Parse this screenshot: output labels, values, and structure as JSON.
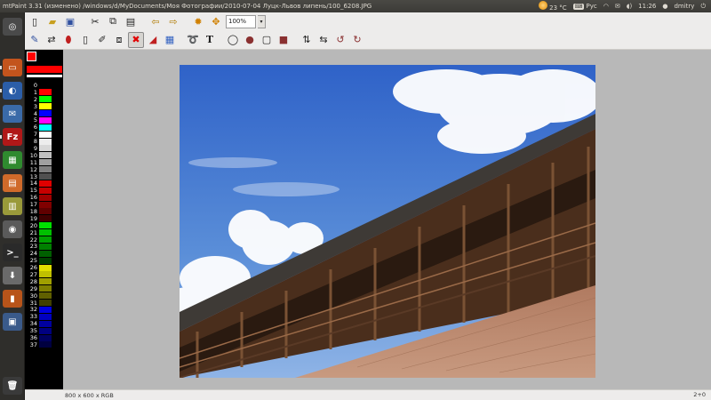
{
  "panel": {
    "title": "mtPaint 3.31 (изменено) /windows/d/MyDocuments/Моя Фотографии/2010-07-04 Луцк-Львов липень/100_6208.JPG",
    "weather": "23 °C",
    "keyboard": "Рус",
    "time": "11:26",
    "user": "dmitry"
  },
  "toolbar": {
    "zoom_value": "100%"
  },
  "status": {
    "image_info": "800 x 600 x RGB",
    "coords": "2+0"
  },
  "palette": [
    {
      "index": "0",
      "color": "#000000"
    },
    {
      "index": "1",
      "color": "#ff0000"
    },
    {
      "index": "2",
      "color": "#00ff00"
    },
    {
      "index": "3",
      "color": "#ffff00"
    },
    {
      "index": "4",
      "color": "#0000ff"
    },
    {
      "index": "5",
      "color": "#ff00ff"
    },
    {
      "index": "6",
      "color": "#00ffff"
    },
    {
      "index": "7",
      "color": "#ffffff"
    },
    {
      "index": "8",
      "color": "#ededed"
    },
    {
      "index": "9",
      "color": "#d8d8d8"
    },
    {
      "index": "10",
      "color": "#c0c0c0"
    },
    {
      "index": "11",
      "color": "#a0a0a0"
    },
    {
      "index": "12",
      "color": "#808080"
    },
    {
      "index": "13",
      "color": "#505050"
    },
    {
      "index": "14",
      "color": "#e00000"
    },
    {
      "index": "15",
      "color": "#c80000"
    },
    {
      "index": "16",
      "color": "#a00000"
    },
    {
      "index": "17",
      "color": "#800000"
    },
    {
      "index": "18",
      "color": "#600000"
    },
    {
      "index": "19",
      "color": "#400000"
    },
    {
      "index": "20",
      "color": "#00e000"
    },
    {
      "index": "21",
      "color": "#00c000"
    },
    {
      "index": "22",
      "color": "#00a000"
    },
    {
      "index": "23",
      "color": "#008000"
    },
    {
      "index": "24",
      "color": "#006000"
    },
    {
      "index": "25",
      "color": "#004000"
    },
    {
      "index": "26",
      "color": "#e0e000"
    },
    {
      "index": "27",
      "color": "#c0c000"
    },
    {
      "index": "28",
      "color": "#a0a000"
    },
    {
      "index": "29",
      "color": "#808000"
    },
    {
      "index": "30",
      "color": "#606000"
    },
    {
      "index": "31",
      "color": "#404000"
    },
    {
      "index": "32",
      "color": "#0000e0"
    },
    {
      "index": "33",
      "color": "#0000c0"
    },
    {
      "index": "34",
      "color": "#0000a0"
    },
    {
      "index": "35",
      "color": "#000080"
    },
    {
      "index": "36",
      "color": "#000060"
    },
    {
      "index": "37",
      "color": "#000040"
    }
  ],
  "launcher": [
    {
      "name": "ubuntu-home-icon",
      "color": "#4a4a4a",
      "glyph": "◎"
    },
    {
      "name": "files-icon",
      "color": "#c3541d",
      "glyph": "▭"
    },
    {
      "name": "firefox-icon",
      "color": "#2b5ea8",
      "glyph": "◐"
    },
    {
      "name": "thunderbird-icon",
      "color": "#3a6aa8",
      "glyph": "✉"
    },
    {
      "name": "filezilla-icon",
      "color": "#b01818",
      "glyph": "Fz"
    },
    {
      "name": "spreadsheet-icon",
      "color": "#2f8a2f",
      "glyph": "▦"
    },
    {
      "name": "software-center-icon",
      "color": "#d06a2a",
      "glyph": "▤"
    },
    {
      "name": "archive-icon",
      "color": "#9a9a3a",
      "glyph": "▥"
    },
    {
      "name": "camera-icon",
      "color": "#5a5a5a",
      "glyph": "◉"
    },
    {
      "name": "terminal-icon",
      "color": "#2a2a2a",
      "glyph": ">_"
    },
    {
      "name": "installer-icon",
      "color": "#6a6a6a",
      "glyph": "⬇"
    },
    {
      "name": "books-icon",
      "color": "#b8541a",
      "glyph": "▮"
    },
    {
      "name": "workspaces-icon",
      "color": "#3a5a8a",
      "glyph": "▣"
    },
    {
      "name": "trash-icon",
      "color": "#3a3a3a",
      "glyph": "🗑"
    }
  ]
}
